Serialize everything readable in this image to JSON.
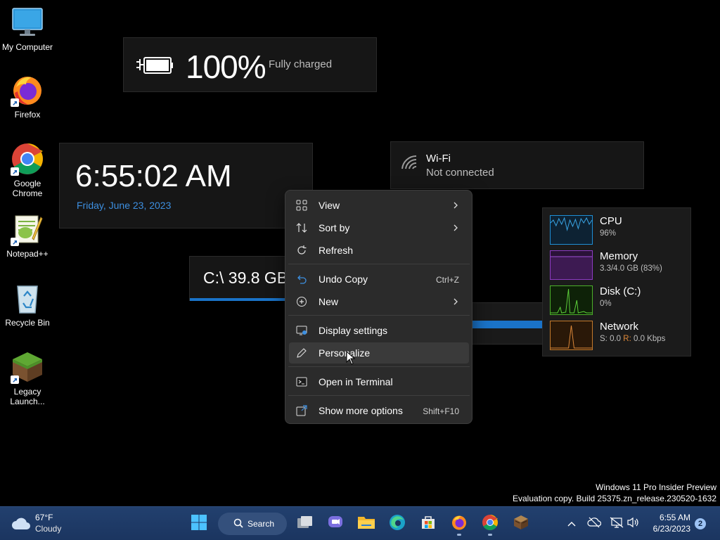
{
  "desktop": {
    "icons": [
      {
        "label": "My Computer"
      },
      {
        "label": "Firefox"
      },
      {
        "label": "Google Chrome"
      },
      {
        "label": "Notepad++"
      },
      {
        "label": "Recycle Bin"
      },
      {
        "label": "Legacy Launch..."
      }
    ]
  },
  "battery_widget": {
    "percent": "100%",
    "status": "Fully charged"
  },
  "clock_widget": {
    "time": "6:55:02 AM",
    "date": "Friday, June 23, 2023"
  },
  "wifi_widget": {
    "name": "Wi-Fi",
    "status": "Not connected"
  },
  "drive_widget": {
    "label": "C:\\  39.8 GB"
  },
  "perf_widget": {
    "cpu": {
      "title": "CPU",
      "value": "96%"
    },
    "memory": {
      "title": "Memory",
      "value": "3.3/4.0 GB (83%)"
    },
    "disk": {
      "title": "Disk (C:)",
      "value": "0%"
    },
    "network": {
      "title": "Network",
      "send_label": "S:",
      "send_value": "0.0",
      "recv_label": "R:",
      "recv_value": "0.0 Kbps"
    }
  },
  "context_menu": {
    "view": "View",
    "sort_by": "Sort by",
    "refresh": "Refresh",
    "undo_copy": "Undo Copy",
    "undo_shortcut": "Ctrl+Z",
    "new": "New",
    "display_settings": "Display settings",
    "personalize": "Personalize",
    "open_terminal": "Open in Terminal",
    "show_more": "Show more options",
    "show_more_shortcut": "Shift+F10"
  },
  "watermark": {
    "line1": "Windows 11 Pro Insider Preview",
    "line2": "Evaluation copy. Build 25375.zn_release.230520-1632"
  },
  "taskbar": {
    "weather_temp": "67°F",
    "weather_cond": "Cloudy",
    "search_label": "Search",
    "clock_time": "6:55 AM",
    "clock_date": "6/23/2023",
    "notification_count": "2"
  },
  "colors": {
    "accent": "#1a73c8",
    "date_blue": "#3d8fe0",
    "cpu": "#1e8fd6",
    "memory": "#8d3bc4",
    "disk": "#4caf2a",
    "network": "#c47a2c"
  }
}
